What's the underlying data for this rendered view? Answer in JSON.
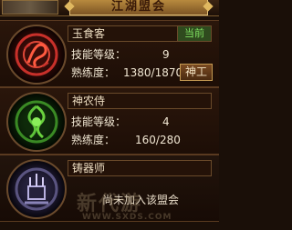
{
  "header": {
    "title": "江湖盟会"
  },
  "labels": {
    "skill_level": "技能等级：",
    "proficiency": "熟练度："
  },
  "cards": [
    {
      "name": "玉食客",
      "badge": "当前",
      "skill_level": "9",
      "proficiency": "1380/1870",
      "button": "神工",
      "emblem_color": "#c8302a"
    },
    {
      "name": "神农侍",
      "skill_level": "4",
      "proficiency": "160/280",
      "emblem_color": "#5ec23a"
    },
    {
      "name": "铸器师",
      "status": "尚未加入该盟会",
      "emblem_color": "#8a84b8"
    }
  ],
  "watermark": {
    "text": "新代游",
    "url": "WWW.SXDS.COM"
  }
}
